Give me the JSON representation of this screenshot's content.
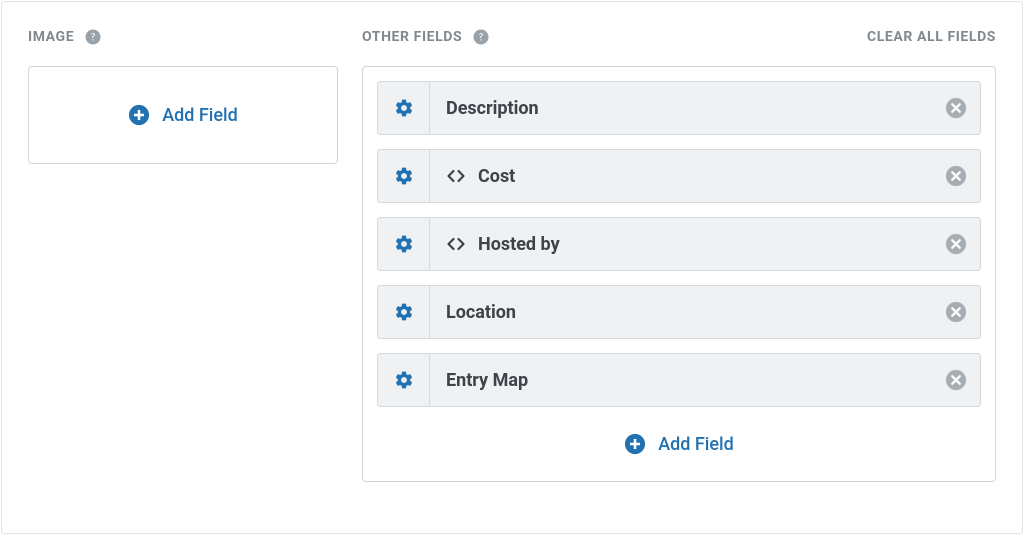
{
  "image_section": {
    "title": "IMAGE",
    "add_field_label": "Add Field"
  },
  "other_section": {
    "title": "OTHER FIELDS",
    "clear_label": "CLEAR ALL FIELDS",
    "add_field_label": "Add Field",
    "fields": [
      {
        "label": "Description",
        "has_code_icon": false
      },
      {
        "label": "Cost",
        "has_code_icon": true
      },
      {
        "label": "Hosted by",
        "has_code_icon": true
      },
      {
        "label": "Location",
        "has_code_icon": false
      },
      {
        "label": "Entry Map",
        "has_code_icon": false
      }
    ]
  }
}
